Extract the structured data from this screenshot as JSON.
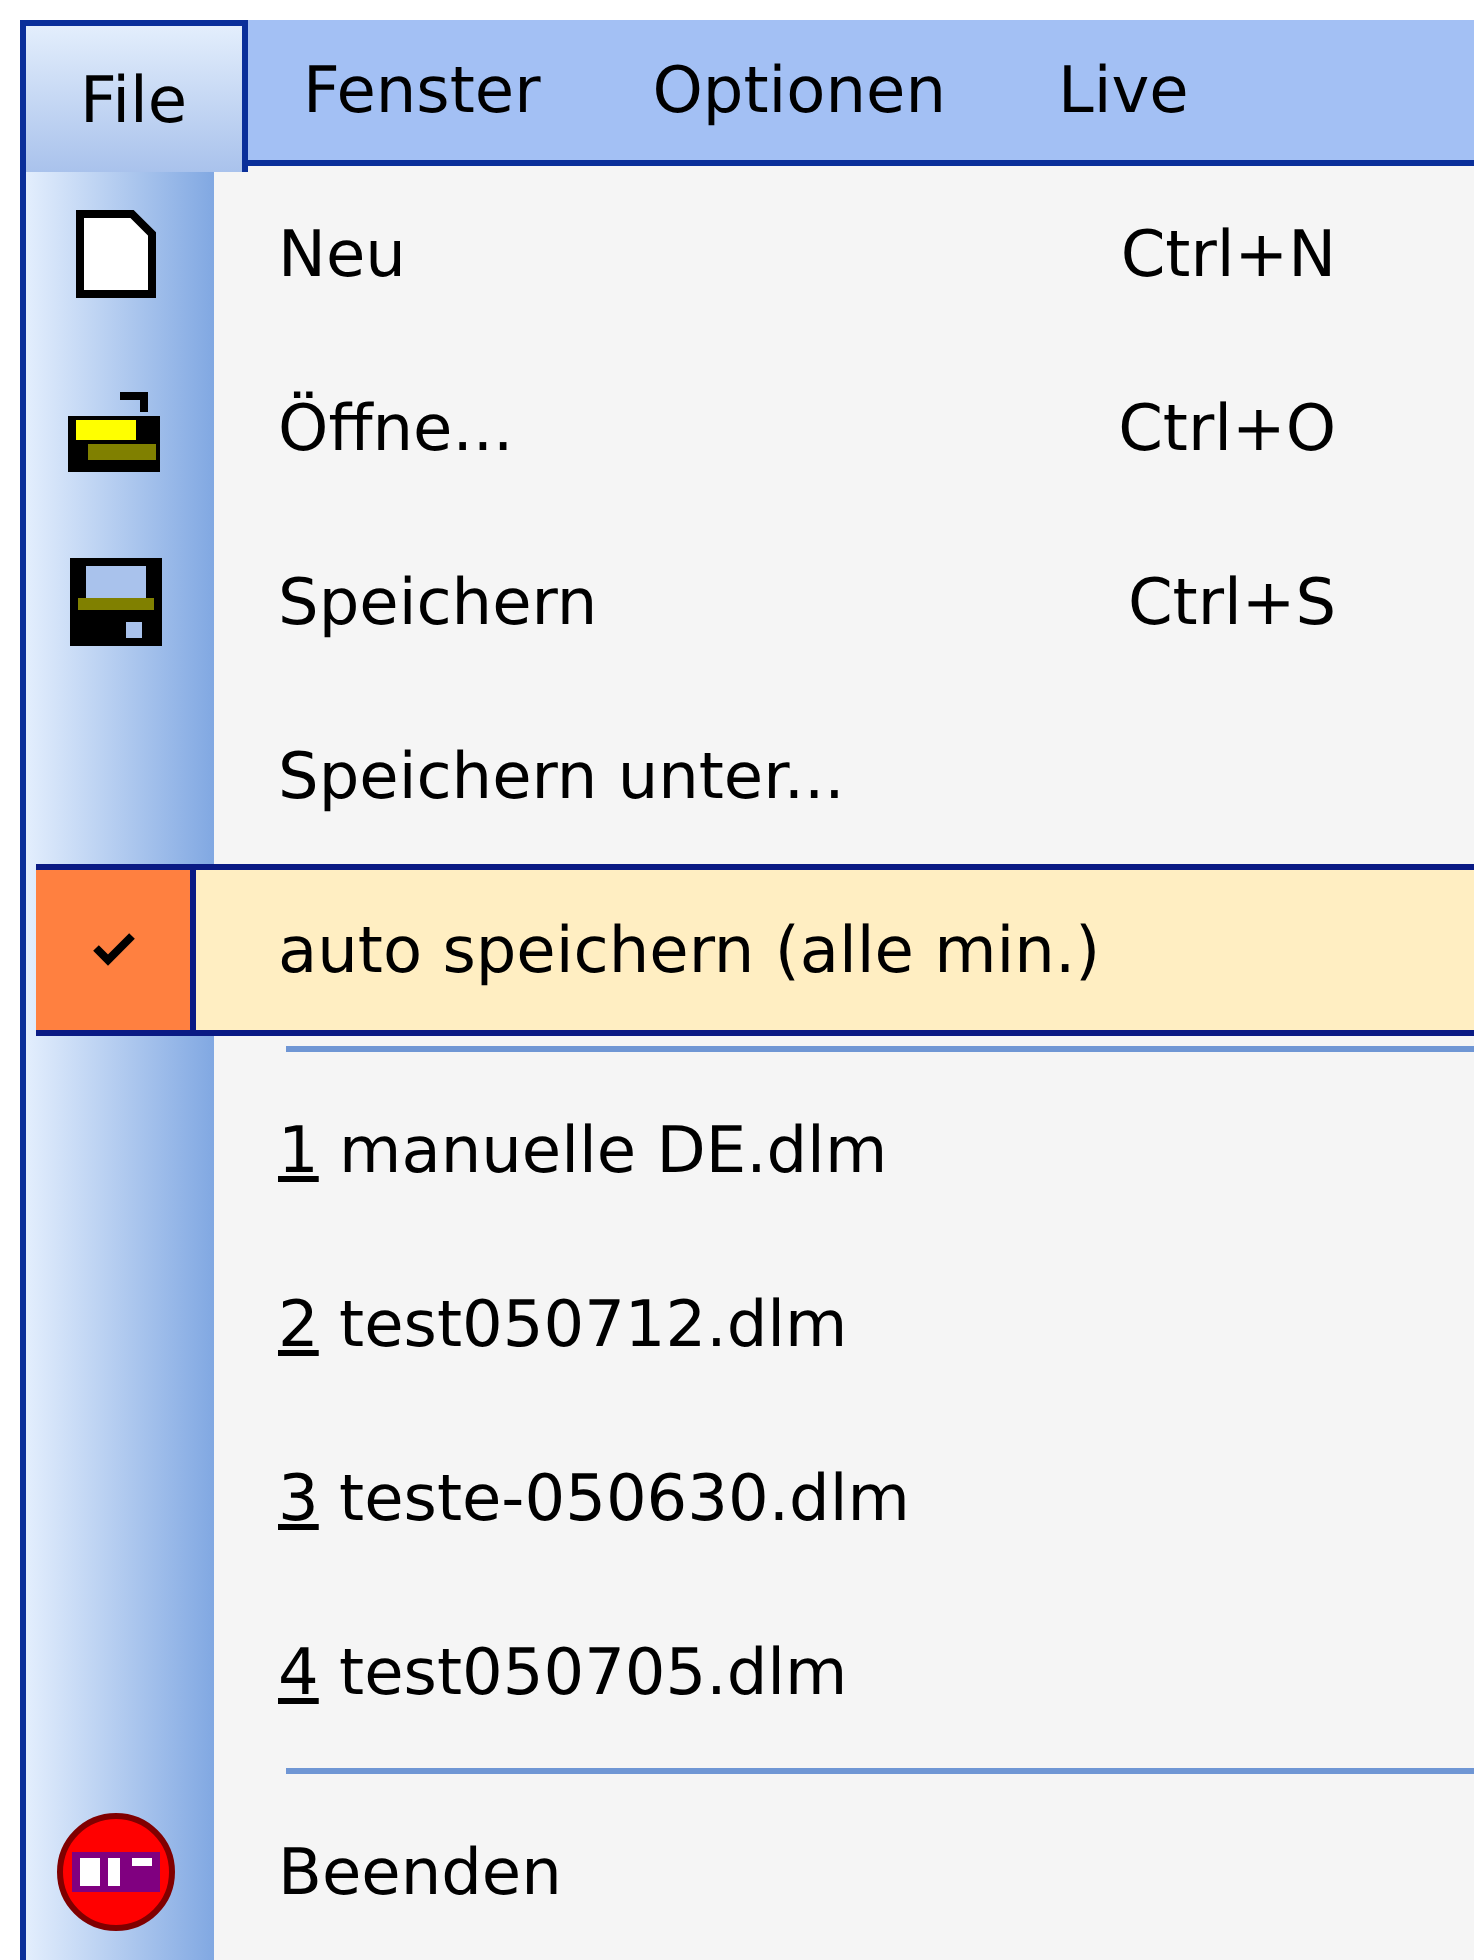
{
  "menubar": [
    {
      "label": "File",
      "selected": true
    },
    {
      "label": "Fenster",
      "selected": false
    },
    {
      "label": "Optionen",
      "selected": false
    },
    {
      "label": "Live",
      "selected": false
    }
  ],
  "menu": [
    {
      "kind": "command",
      "label": "Neu",
      "shortcut": "Ctrl+N",
      "highlighted": false
    },
    {
      "kind": "command",
      "label": "Öffne...",
      "shortcut": "Ctrl+O",
      "highlighted": false
    },
    {
      "kind": "command",
      "label": "Speichern",
      "shortcut": "Ctrl+S",
      "highlighted": false
    },
    {
      "kind": "command",
      "label": "Speichern unter...",
      "highlighted": false
    },
    {
      "kind": "checkable",
      "label": "auto speichern (alle min.)",
      "checked": true,
      "highlighted": true
    },
    {
      "kind": "separator"
    },
    {
      "kind": "recent",
      "number": "1",
      "label": "manuelle DE.dlm",
      "highlighted": false
    },
    {
      "kind": "recent",
      "number": "2",
      "label": "test050712.dlm",
      "highlighted": false
    },
    {
      "kind": "recent",
      "number": "3",
      "label": "teste-050630.dlm",
      "highlighted": false
    },
    {
      "kind": "recent",
      "number": "4",
      "label": "test050705.dlm",
      "highlighted": false
    },
    {
      "kind": "separator"
    },
    {
      "kind": "command",
      "label": "Beenden",
      "highlighted": false
    }
  ]
}
